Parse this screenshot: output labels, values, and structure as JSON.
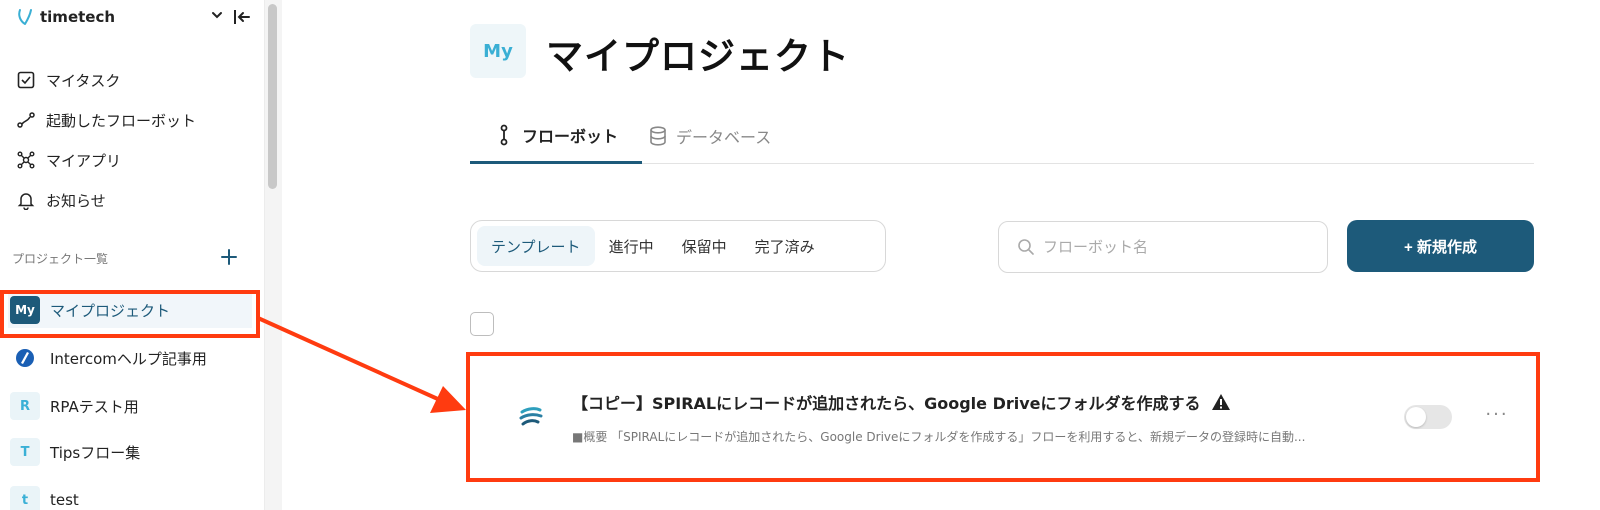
{
  "brand": {
    "name": "timetech"
  },
  "sidebar": {
    "nav": [
      {
        "label": "マイタスク",
        "icon": "checkbox-icon"
      },
      {
        "label": "起動したフローボット",
        "icon": "flow-route-icon"
      },
      {
        "label": "マイアプリ",
        "icon": "app-network-icon"
      },
      {
        "label": "お知らせ",
        "icon": "bell-icon"
      }
    ],
    "section_label": "プロジェクト一覧",
    "projects": [
      {
        "badge": "My",
        "label": "マイプロジェクト",
        "active": true
      },
      {
        "badge": "",
        "label": "Intercomヘルプ記事用",
        "icon": "intercom-logo-icon"
      },
      {
        "badge": "R",
        "label": "RPAテスト用"
      },
      {
        "badge": "T",
        "label": "Tipsフロー集"
      },
      {
        "badge": "t",
        "label": "test"
      }
    ]
  },
  "main": {
    "page_badge": "My",
    "title": "マイプロジェクト",
    "tabs": [
      {
        "label": "フローボット",
        "active": true,
        "icon": "flowbot-icon"
      },
      {
        "label": "データベース",
        "active": false,
        "icon": "database-icon"
      }
    ],
    "filters": [
      {
        "label": "テンプレート",
        "active": true
      },
      {
        "label": "進行中"
      },
      {
        "label": "保留中"
      },
      {
        "label": "完了済み"
      }
    ],
    "search": {
      "placeholder": "フローボット名",
      "value": ""
    },
    "new_button": "+ 新規作成",
    "flows": [
      {
        "title": "【コピー】SPIRALにレコードが追加されたら、Google Driveにフォルダを作成する",
        "description": "■概要 「SPIRALにレコードが追加されたら、Google Driveにフォルダを作成する」フローを利用すると、新規データの登録時に自動...",
        "enabled": false,
        "more": "···"
      }
    ]
  },
  "colors": {
    "primary": "#1d5a7a",
    "highlight": "#ff3b10",
    "accent": "#3aafd4"
  }
}
